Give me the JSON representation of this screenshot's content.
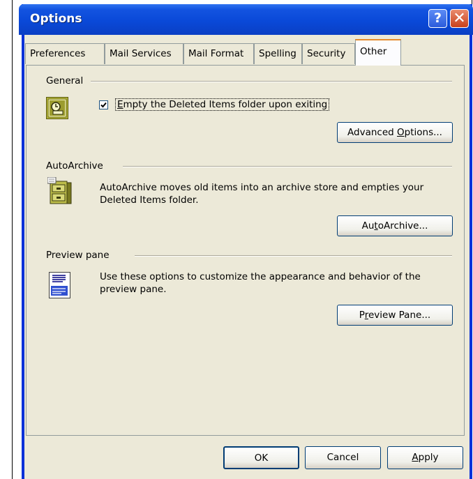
{
  "window": {
    "title": "Options",
    "help_glyph": "?",
    "close_glyph": "✕"
  },
  "tabs": [
    {
      "label": "Preferences",
      "active": false
    },
    {
      "label": "Mail Services",
      "active": false
    },
    {
      "label": "Mail Format",
      "active": false
    },
    {
      "label": "Spelling",
      "active": false
    },
    {
      "label": "Security",
      "active": false
    },
    {
      "label": "Other",
      "active": true
    }
  ],
  "general": {
    "heading": "General",
    "icon": "outlook-options-icon",
    "checkbox_label_pre": "",
    "checkbox_label_ul": "E",
    "checkbox_label_post": "mpty the Deleted Items folder upon exiting",
    "checkbox_checked": true,
    "advanced_pre": "Advanced ",
    "advanced_ul": "O",
    "advanced_post": "ptions..."
  },
  "autoarchive": {
    "heading": "AutoArchive",
    "icon": "filing-cabinet-icon",
    "description_line1": "AutoArchive moves old items into an archive store and empties your",
    "description_line2": "Deleted Items folder.",
    "button_pre": "Au",
    "button_ul": "t",
    "button_post": "oArchive..."
  },
  "preview": {
    "heading": "Preview pane",
    "icon": "preview-pane-icon",
    "description_line1": "Use these options to customize the appearance and behavior of the",
    "description_line2": "preview pane.",
    "button_pre": "P",
    "button_ul": "r",
    "button_post": "eview Pane..."
  },
  "footer": {
    "ok": "OK",
    "cancel": "Cancel",
    "apply_ul": "A",
    "apply_post": "pply"
  }
}
